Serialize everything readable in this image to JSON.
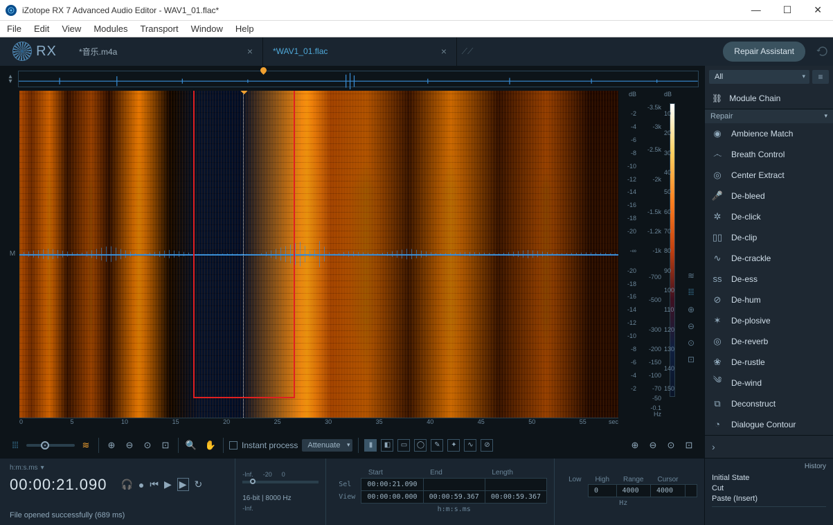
{
  "titlebar": {
    "app_title": "iZotope RX 7 Advanced Audio Editor - WAV1_01.flac*"
  },
  "menubar": [
    "File",
    "Edit",
    "View",
    "Modules",
    "Transport",
    "Window",
    "Help"
  ],
  "logo_text": "RX",
  "tabs": [
    {
      "name": "*音乐.m4a",
      "active": false
    },
    {
      "name": "*WAV1_01.flac",
      "active": true
    }
  ],
  "repair_button": "Repair Assistant",
  "spectro": {
    "channel_label": "M",
    "db_unit": "dB",
    "hz_unit": "Hz",
    "sec_unit": "sec",
    "db_ticks": [
      "-2",
      "-4",
      "-6",
      "-8",
      "-10",
      "-12",
      "-14",
      "-16",
      "-18",
      "-20",
      "-∞",
      "-20",
      "-18",
      "-16",
      "-14",
      "-12",
      "-10",
      "-8",
      "-6",
      "-4",
      "-2"
    ],
    "freq_ticks": [
      "-3.5k",
      "-3k",
      "-2.5k",
      "-2k",
      "-1.5k",
      "-1.2k",
      "-1k",
      "-700",
      "-500",
      "-300",
      "-200",
      "-150",
      "-100",
      "-70",
      "-50",
      "-0.1"
    ],
    "color_ticks": [
      "10",
      "20",
      "30",
      "40",
      "50",
      "60",
      "70",
      "80",
      "90",
      "100",
      "110",
      "120",
      "130",
      "140",
      "150"
    ],
    "time_ticks": [
      "0",
      "5",
      "10",
      "15",
      "20",
      "25",
      "30",
      "35",
      "40",
      "45",
      "50",
      "55"
    ]
  },
  "toolbar": {
    "instant_process": "Instant process",
    "mode": "Attenuate"
  },
  "rightpanel": {
    "filter": "All",
    "module_chain": "Module Chain",
    "section": "Repair",
    "modules": [
      "Ambience Match",
      "Breath Control",
      "Center Extract",
      "De-bleed",
      "De-click",
      "De-clip",
      "De-crackle",
      "De-ess",
      "De-hum",
      "De-plosive",
      "De-reverb",
      "De-rustle",
      "De-wind",
      "Deconstruct",
      "Dialogue Contour"
    ]
  },
  "status": {
    "time_format": "h:m:s.ms",
    "timecode": "00:00:21.090",
    "message": "File opened successfully (689 ms)",
    "meter_labels": [
      "-Inf.",
      "-20",
      "0"
    ],
    "bitdepth": "16-bit | 8000 Hz",
    "headers": [
      "Start",
      "End",
      "Length"
    ],
    "sel_label": "Sel",
    "view_label": "View",
    "sel": [
      "00:00:21.090",
      "",
      ""
    ],
    "view": [
      "00:00:00.000",
      "00:00:59.367",
      "00:00:59.367"
    ],
    "unit_label": "h:m:s.ms",
    "range_headers": [
      "Low",
      "High",
      "Range",
      "Cursor"
    ],
    "range": [
      "0",
      "4000",
      "4000",
      ""
    ],
    "range_unit": "Hz"
  },
  "history": {
    "title": "History",
    "items": [
      "Initial State",
      "Cut",
      "Paste (Insert)"
    ]
  }
}
